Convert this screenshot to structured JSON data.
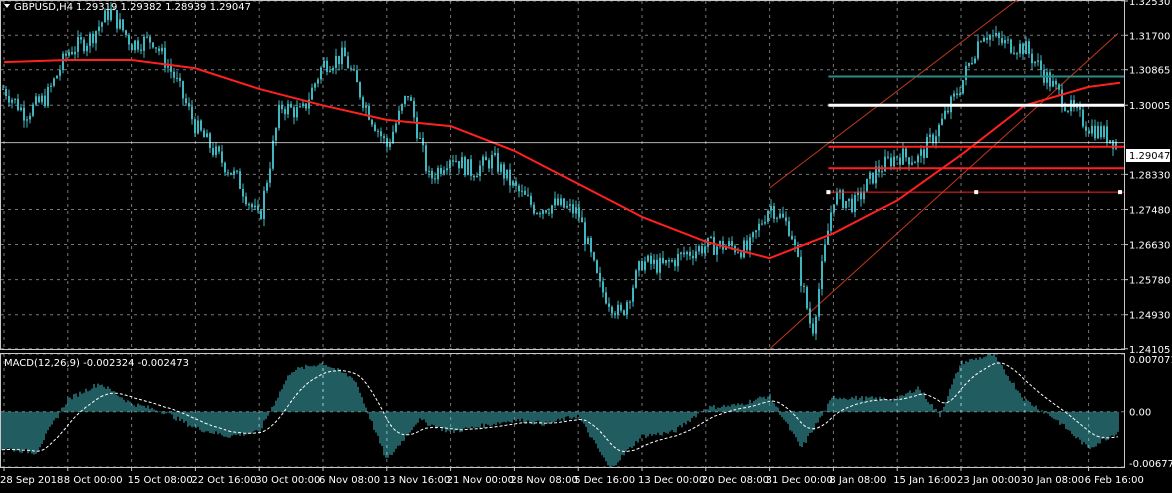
{
  "header": {
    "symbol": "GBPUSD,H4",
    "ohlc": "1.29319 1.29382 1.28939 1.29047"
  },
  "macd_header": "MACD(12,26,9) -0.002324 -0.002473",
  "colors": {
    "background": "#000000",
    "grid": "#c8c8c8",
    "candle": "#3fb7c0",
    "ma": "#ff2020",
    "hlines": "#ff2020",
    "white_level": "#ffffff",
    "teal_level": "#2a8b8b",
    "channel": "#c0391b",
    "signal": "#ffffff",
    "text": "#ffffff",
    "current_label_bg": "#ffffff",
    "current_label_text": "#000000"
  },
  "chart_data": [
    {
      "type": "candlestick",
      "symbol": "GBPUSD",
      "timeframe": "H4",
      "ylim": [
        1.241,
        1.3253
      ],
      "y_ticks": [
        "1.32530",
        "1.31700",
        "1.30865",
        "1.30005",
        "1.28330",
        "1.27480",
        "1.26630",
        "1.25780",
        "1.24930",
        "1.24105"
      ],
      "current_price": "1.29047",
      "x_tick_labels": [
        "28 Sep 2018",
        "8 Oct 00:00",
        "15 Oct 08:00",
        "22 Oct 16:00",
        "30 Oct 00:00",
        "6 Nov 08:00",
        "13 Nov 16:00",
        "21 Nov 00:00",
        "28 Nov 08:00",
        "5 Dec 16:00",
        "13 Dec 00:00",
        "20 Dec 08:00",
        "31 Dec 00:00",
        "8 Jan 08:00",
        "15 Jan 16:00",
        "23 Jan 00:00",
        "30 Jan 08:00",
        "6 Feb 16:00"
      ],
      "price_path": [
        [
          "28 Sep 2018",
          1.304
        ],
        [
          "2 Oct",
          1.298
        ],
        [
          "4 Oct",
          1.302
        ],
        [
          "8 Oct 00:00",
          1.313
        ],
        [
          "10 Oct",
          1.316
        ],
        [
          "12 Oct",
          1.323
        ],
        [
          "15 Oct 08:00",
          1.315
        ],
        [
          "17 Oct",
          1.316
        ],
        [
          "19 Oct",
          1.307
        ],
        [
          "22 Oct 16:00",
          1.295
        ],
        [
          "24 Oct",
          1.288
        ],
        [
          "26 Oct",
          1.282
        ],
        [
          "30 Oct 00:00",
          1.272
        ],
        [
          "1 Nov",
          1.3
        ],
        [
          "2 Nov",
          1.298
        ],
        [
          "6 Nov 08:00",
          1.31
        ],
        [
          "8 Nov",
          1.312
        ],
        [
          "9 Nov",
          1.3
        ],
        [
          "13 Nov 16:00",
          1.29
        ],
        [
          "15 Nov",
          1.303
        ],
        [
          "16 Nov",
          1.282
        ],
        [
          "21 Nov 00:00",
          1.288
        ],
        [
          "23 Nov",
          1.284
        ],
        [
          "26 Nov",
          1.287
        ],
        [
          "28 Nov 08:00",
          1.28
        ],
        [
          "30 Nov",
          1.275
        ],
        [
          "3 Dec",
          1.276
        ],
        [
          "5 Dec 16:00",
          1.274
        ],
        [
          "7 Dec",
          1.256
        ],
        [
          "11 Dec",
          1.249
        ],
        [
          "13 Dec 00:00",
          1.262
        ],
        [
          "17 Dec",
          1.261
        ],
        [
          "18 Dec",
          1.264
        ],
        [
          "20 Dec 08:00",
          1.266
        ],
        [
          "24 Dec",
          1.266
        ],
        [
          "27 Dec",
          1.265
        ],
        [
          "31 Dec 00:00",
          1.276
        ],
        [
          "2 Jan",
          1.27
        ],
        [
          "3 Jan",
          1.245
        ],
        [
          "8 Jan 08:00",
          1.278
        ],
        [
          "10 Jan",
          1.276
        ],
        [
          "11 Jan",
          1.284
        ],
        [
          "15 Jan 16:00",
          1.288
        ],
        [
          "17 Jan",
          1.287
        ],
        [
          "21 Jan",
          1.295
        ],
        [
          "23 Jan 00:00",
          1.305
        ],
        [
          "25 Jan",
          1.318
        ],
        [
          "28 Jan",
          1.315
        ],
        [
          "30 Jan 08:00",
          1.314
        ],
        [
          "1 Feb",
          1.307
        ],
        [
          "4 Feb",
          1.3
        ],
        [
          "6 Feb 16:00",
          1.295
        ],
        [
          "8 Feb",
          1.293
        ],
        [
          "now",
          1.29047
        ]
      ],
      "moving_average_path": [
        [
          "28 Sep 2018",
          1.3105
        ],
        [
          "8 Oct 00:00",
          1.311
        ],
        [
          "15 Oct 08:00",
          1.311
        ],
        [
          "22 Oct 16:00",
          1.309
        ],
        [
          "30 Oct 00:00",
          1.304
        ],
        [
          "6 Nov 08:00",
          1.3
        ],
        [
          "13 Nov 16:00",
          1.2965
        ],
        [
          "21 Nov 00:00",
          1.295
        ],
        [
          "28 Nov 08:00",
          1.289
        ],
        [
          "5 Dec 16:00",
          1.281
        ],
        [
          "13 Dec 00:00",
          1.273
        ],
        [
          "20 Dec 08:00",
          1.267
        ],
        [
          "31 Dec 00:00",
          1.263
        ],
        [
          "8 Jan 08:00",
          1.269
        ],
        [
          "15 Jan 16:00",
          1.277
        ],
        [
          "23 Jan 00:00",
          1.288
        ],
        [
          "30 Jan 08:00",
          1.3
        ],
        [
          "6 Feb 16:00",
          1.3045
        ],
        [
          "now",
          1.3055
        ]
      ],
      "horizontal_levels": [
        {
          "price": 1.30005,
          "color": "white",
          "start": "8 Jan 08:00"
        },
        {
          "price": 1.307,
          "color": "teal",
          "start": "8 Jan 08:00"
        },
        {
          "price": 1.291,
          "color": "white",
          "start": "28 Sep 2018"
        },
        {
          "price": 1.29,
          "color": "red",
          "start": "8 Jan 08:00"
        },
        {
          "price": 1.2848,
          "color": "red",
          "start": "8 Jan 08:00"
        },
        {
          "price": 1.279,
          "color": "red",
          "start": "8 Jan 08:00",
          "markers": true
        }
      ],
      "channel_lines": [
        {
          "from": [
            "31 Dec 00:00",
            1.28
          ],
          "to": [
            "30 Jan 08:00",
            1.327
          ]
        },
        {
          "from": [
            "31 Dec 00:00",
            1.241
          ],
          "to": [
            "6 Feb 16:00",
            1.311
          ]
        }
      ]
    },
    {
      "type": "bar",
      "indicator": "MACD(12,26,9)",
      "main_value": "-0.002324",
      "signal_value": "-0.002473",
      "ylim": [
        -0.006772,
        0.007071
      ],
      "y_ticks": [
        "0.007071",
        "0.00",
        "-0.006772"
      ],
      "macd_path": [
        [
          "28 Sep 2018",
          -0.0045
        ],
        [
          "3 Oct",
          -0.005
        ],
        [
          "8 Oct 00:00",
          0.0015
        ],
        [
          "11 Oct",
          0.0035
        ],
        [
          "15 Oct 08:00",
          0.001
        ],
        [
          "17 Oct",
          0.0
        ],
        [
          "22 Oct 16:00",
          -0.002
        ],
        [
          "26 Oct",
          -0.003
        ],
        [
          "30 Oct 00:00",
          -0.0025
        ],
        [
          "2 Nov",
          0.005
        ],
        [
          "6 Nov 08:00",
          0.006
        ],
        [
          "8 Nov",
          0.004
        ],
        [
          "13 Nov 16:00",
          -0.006
        ],
        [
          "16 Nov",
          -0.001
        ],
        [
          "21 Nov 00:00",
          -0.0025
        ],
        [
          "28 Nov 08:00",
          -0.001
        ],
        [
          "30 Nov",
          -0.0015
        ],
        [
          "5 Dec 16:00",
          -0.0005
        ],
        [
          "11 Dec",
          -0.007
        ],
        [
          "13 Dec 00:00",
          -0.003
        ],
        [
          "17 Dec",
          -0.0025
        ],
        [
          "20 Dec 08:00",
          0.0005
        ],
        [
          "27 Dec",
          0.0008
        ],
        [
          "31 Dec 00:00",
          0.002
        ],
        [
          "3 Jan",
          -0.0045
        ],
        [
          "8 Jan 08:00",
          0.0018
        ],
        [
          "15 Jan 16:00",
          0.0015
        ],
        [
          "17 Jan",
          0.003
        ],
        [
          "21 Jan",
          -0.0005
        ],
        [
          "23 Jan 00:00",
          0.006
        ],
        [
          "25 Jan",
          0.007
        ],
        [
          "30 Jan 08:00",
          0.0015
        ],
        [
          "4 Feb",
          -0.001
        ],
        [
          "6 Feb 16:00",
          -0.0045
        ],
        [
          "now",
          -0.002324
        ]
      ]
    }
  ]
}
